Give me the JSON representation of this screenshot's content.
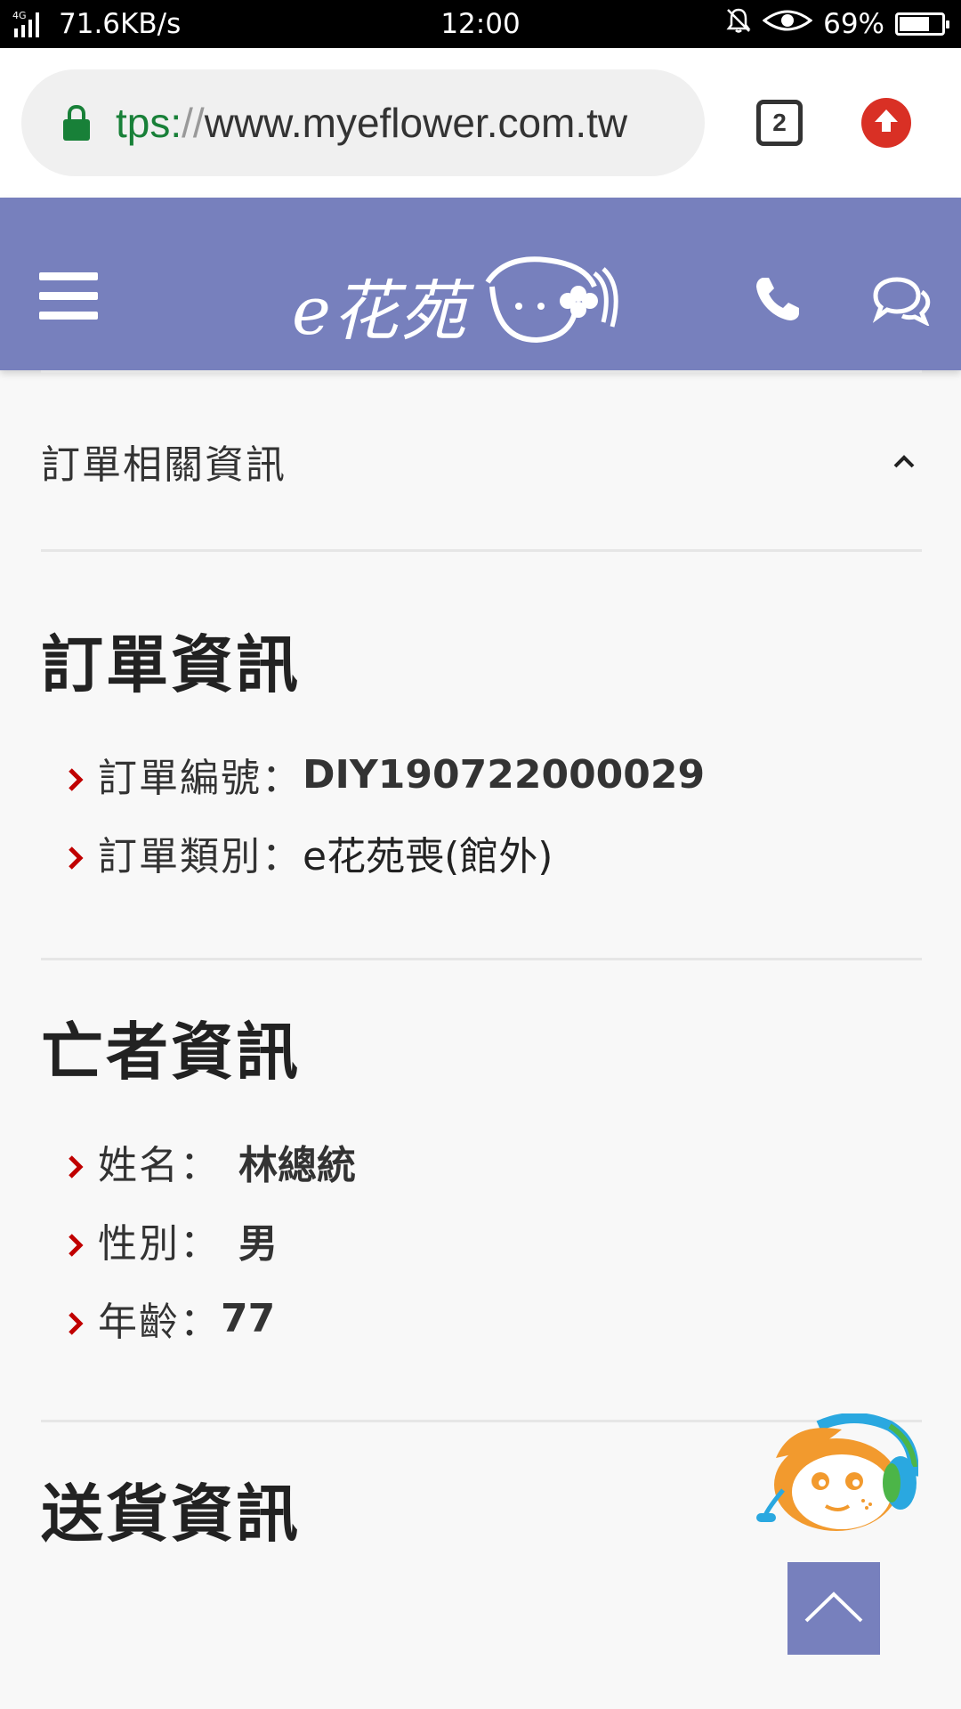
{
  "status_bar": {
    "network": "4G",
    "speed": "71.6KB/s",
    "time": "12:00",
    "battery": "69%"
  },
  "browser": {
    "url_scheme": "tps:",
    "url_sep": "//",
    "url_host": "www.myeflower.com.tw",
    "tab_count": "2"
  },
  "header": {
    "logo_text": "e花苑",
    "colors": {
      "brand": "#7780bd",
      "accent_arrow": "#c00000"
    }
  },
  "accordion": {
    "title": "訂單相關資訊",
    "state": "expanded"
  },
  "sections": {
    "order": {
      "title": "訂單資訊",
      "items": [
        {
          "label": "訂單編號：",
          "value": "DIY190722000029"
        },
        {
          "label": "訂單類別：",
          "value": "e花苑喪(館外)"
        }
      ]
    },
    "deceased": {
      "title": "亡者資訊",
      "items": [
        {
          "label": "姓名：",
          "value": "林總統"
        },
        {
          "label": "性別：",
          "value": "男"
        },
        {
          "label": "年齡：",
          "value": "77"
        }
      ]
    },
    "delivery": {
      "title": "送貨資訊"
    }
  }
}
